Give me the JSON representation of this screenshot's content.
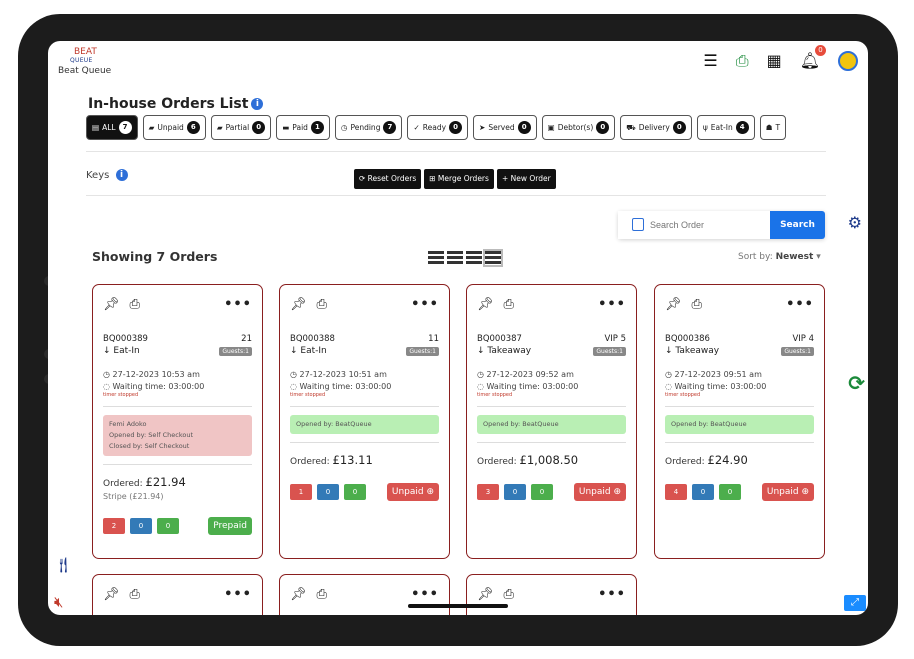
{
  "header": {
    "logo_mark": "BEAT",
    "logo_sub": "QUEUE",
    "app_title": "Beat Queue",
    "notification_count": "0"
  },
  "page": {
    "title": "In-house Orders List",
    "keys_label": "Keys",
    "showing": "Showing 7 Orders",
    "sort_label": "Sort by:",
    "sort_value": "Newest"
  },
  "filters": [
    {
      "label": "ALL",
      "count": "7"
    },
    {
      "label": "Unpaid",
      "count": "6"
    },
    {
      "label": "Partial",
      "count": "0"
    },
    {
      "label": "Paid",
      "count": "1"
    },
    {
      "label": "Pending",
      "count": "7"
    },
    {
      "label": "Ready",
      "count": "0"
    },
    {
      "label": "Served",
      "count": "0"
    },
    {
      "label": "Debtor(s)",
      "count": "0"
    },
    {
      "label": "Delivery",
      "count": "0"
    },
    {
      "label": "Eat-In",
      "count": "4"
    },
    {
      "label": "T",
      "count": ""
    }
  ],
  "actions": {
    "reset": "Reset Orders",
    "merge": "Merge Orders",
    "new": "New Order"
  },
  "search": {
    "placeholder": "Search Order",
    "button": "Search"
  },
  "orders": [
    {
      "id": "BQ000389",
      "table": "21",
      "type": "Eat-In",
      "guests": "Guests:1",
      "datetime": "27-12-2023 10:53 am",
      "waiting": "Waiting time: 03:00:00",
      "timer": "timer stopped",
      "note_lines": [
        "Femi Adoko",
        "Opened by: Self Checkout",
        "Closed by: Self Checkout"
      ],
      "note_color": "pink",
      "ordered_label": "Ordered:",
      "amount": "£21.94",
      "payment": "Stripe (£21.94)",
      "counts": [
        "2",
        "0",
        "0"
      ],
      "status": "Prepaid"
    },
    {
      "id": "BQ000388",
      "table": "11",
      "type": "Eat-In",
      "guests": "Guests:1",
      "datetime": "27-12-2023 10:51 am",
      "waiting": "Waiting time: 03:00:00",
      "timer": "timer stopped",
      "note_lines": [
        "Opened by: BeatQueue"
      ],
      "note_color": "green",
      "ordered_label": "Ordered:",
      "amount": "£13.11",
      "payment": "",
      "counts": [
        "1",
        "0",
        "0"
      ],
      "status": "Unpaid"
    },
    {
      "id": "BQ000387",
      "table": "VIP 5",
      "type": "Takeaway",
      "guests": "Guests:1",
      "datetime": "27-12-2023 09:52 am",
      "waiting": "Waiting time: 03:00:00",
      "timer": "timer stopped",
      "note_lines": [
        "Opened by: BeatQueue"
      ],
      "note_color": "green",
      "ordered_label": "Ordered:",
      "amount": "£1,008.50",
      "payment": "",
      "counts": [
        "3",
        "0",
        "0"
      ],
      "status": "Unpaid"
    },
    {
      "id": "BQ000386",
      "table": "VIP 4",
      "type": "Takeaway",
      "guests": "Guests:1",
      "datetime": "27-12-2023 09:51 am",
      "waiting": "Waiting time: 03:00:00",
      "timer": "timer stopped",
      "note_lines": [
        "Opened by: BeatQueue"
      ],
      "note_color": "green",
      "ordered_label": "Ordered:",
      "amount": "£24.90",
      "payment": "",
      "counts": [
        "4",
        "0",
        "0"
      ],
      "status": "Unpaid"
    }
  ],
  "icons": {
    "pin": "pin-icon",
    "printer": "printer-icon",
    "more": "more-dots-icon",
    "utensils": "utensils-icon",
    "mute": "speaker-mute-icon",
    "settings": "gear-icon",
    "refresh": "refresh-icon",
    "expand": "expand-icon"
  },
  "colors": {
    "card_border": "#8a1f1f",
    "accent_blue": "#1a73e8",
    "status_red": "#d9534f",
    "status_green": "#4cae4c",
    "status_blue": "#337ab7"
  }
}
